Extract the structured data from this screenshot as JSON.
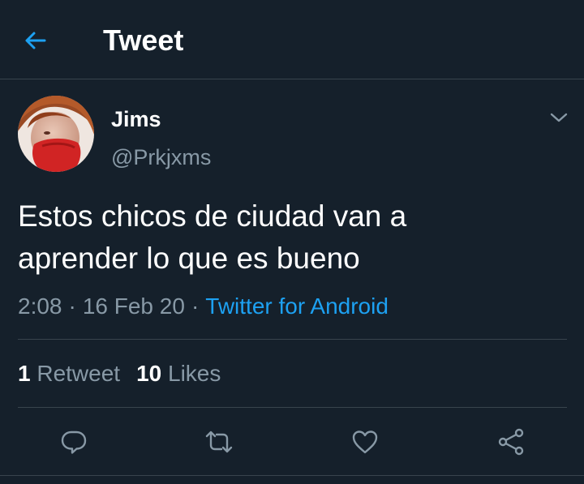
{
  "header": {
    "back_icon": "arrow-left-icon",
    "title": "Tweet"
  },
  "author": {
    "name": "Jims",
    "handle": "@Prkjxms",
    "avatar_icon": "avatar-photo"
  },
  "tweet": {
    "text": "Estos chicos de ciudad van a\naprender lo que es bueno",
    "time": "2:08",
    "date": "16 Feb 20",
    "source": "Twitter for Android",
    "separator": "·",
    "more_icon": "chevron-down-icon"
  },
  "stats": {
    "retweets_count": "1",
    "retweets_label": "Retweet",
    "likes_count": "10",
    "likes_label": "Likes"
  },
  "actions": [
    {
      "icon": "reply-icon"
    },
    {
      "icon": "retweet-icon"
    },
    {
      "icon": "like-icon"
    },
    {
      "icon": "share-icon"
    }
  ],
  "colors": {
    "background": "#15202b",
    "text_primary": "#ffffff",
    "text_secondary": "#8899a6",
    "accent": "#1da1f2",
    "divider": "#38444d"
  }
}
